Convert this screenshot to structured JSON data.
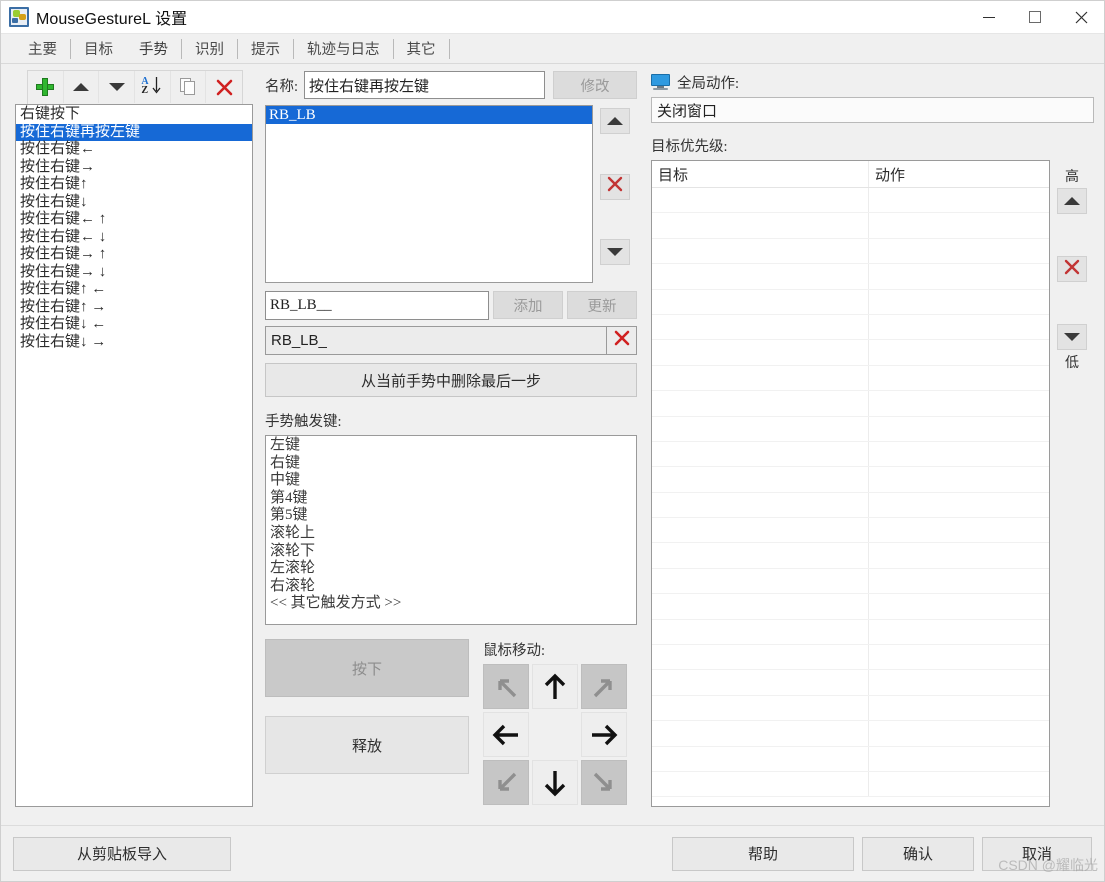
{
  "window": {
    "title": "MouseGestureL 设置",
    "app_icon": "app-icon",
    "minimize": "−",
    "maximize": "□",
    "close": "✕"
  },
  "tabs": [
    {
      "label": "主要",
      "active": false
    },
    {
      "label": "目标",
      "active": false
    },
    {
      "label": "手势",
      "active": true
    },
    {
      "label": "识别",
      "active": false
    },
    {
      "label": "提示",
      "active": false
    },
    {
      "label": "轨迹与日志",
      "active": false
    },
    {
      "label": "其它",
      "active": false
    }
  ],
  "toolbar": {
    "add": "add-icon",
    "move_up": "arrow-up-icon",
    "move_down": "arrow-down-icon",
    "sort": "sort-az-icon",
    "duplicate": "copy-icon",
    "delete": "delete-icon"
  },
  "gesture_list": {
    "items": [
      {
        "label": "右键按下",
        "selected": false
      },
      {
        "label": "按住右键再按左键",
        "selected": true
      },
      {
        "label": "按住右键←",
        "selected": false
      },
      {
        "label": "按住右键→",
        "selected": false
      },
      {
        "label": "按住右键↑",
        "selected": false
      },
      {
        "label": "按住右键↓",
        "selected": false
      },
      {
        "label": "按住右键← ↑",
        "selected": false
      },
      {
        "label": "按住右键← ↓",
        "selected": false
      },
      {
        "label": "按住右键→ ↑",
        "selected": false
      },
      {
        "label": "按住右键→ ↓",
        "selected": false
      },
      {
        "label": "按住右键↑ ←",
        "selected": false
      },
      {
        "label": "按住右键↑ →",
        "selected": false
      },
      {
        "label": "按住右键↓ ←",
        "selected": false
      },
      {
        "label": "按住右键↓ →",
        "selected": false
      }
    ]
  },
  "editor": {
    "name_label": "名称:",
    "name_value": "按住右键再按左键",
    "modify_button": "修改",
    "steps": [
      {
        "label": "RB_LB",
        "selected": true
      }
    ],
    "step_up": "arrow-up-icon",
    "step_delete": "delete-icon",
    "step_down": "arrow-down-icon",
    "add_value": "RB_LB__",
    "add_button": "添加",
    "update_button": "更新",
    "sequence_value": "RB_LB_",
    "sequence_clear": "delete-icon",
    "remove_last_step_button": "从当前手势中删除最后一步"
  },
  "trigger": {
    "label": "手势触发键:",
    "items": [
      "左键",
      "右键",
      "中键",
      "第4键",
      "第5键",
      "滚轮上",
      "滚轮下",
      "左滚轮",
      "右滚轮",
      "<<  其它触发方式  >>"
    ]
  },
  "actions": {
    "press_button": "按下",
    "release_button": "释放",
    "move_label": "鼠标移动:",
    "directions": [
      {
        "name": "up-left",
        "glyph": "↖",
        "enabled": false
      },
      {
        "name": "up",
        "glyph": "↑",
        "enabled": true
      },
      {
        "name": "up-right",
        "glyph": "↗",
        "enabled": false
      },
      {
        "name": "left",
        "glyph": "←",
        "enabled": true
      },
      {
        "name": "center",
        "glyph": "",
        "enabled": false
      },
      {
        "name": "right",
        "glyph": "→",
        "enabled": true
      },
      {
        "name": "down-left",
        "glyph": "↙",
        "enabled": false
      },
      {
        "name": "down",
        "glyph": "↓",
        "enabled": true
      },
      {
        "name": "down-right",
        "glyph": "↘",
        "enabled": false
      }
    ]
  },
  "right_panel": {
    "global_action_label": "全局动作:",
    "global_action_value": "关闭窗口",
    "priority_label": "目标优先级:",
    "table": {
      "columns": [
        "目标",
        "动作"
      ],
      "rows": []
    },
    "high_label": "高",
    "low_label": "低",
    "move_up": "arrow-up-icon",
    "delete": "delete-icon",
    "move_down": "arrow-down-icon"
  },
  "footer": {
    "import_button": "从剪贴板导入",
    "help_button": "帮助",
    "ok_button": "确认",
    "cancel_button": "取消",
    "watermark": "CSDN @耀临光"
  },
  "colors": {
    "selection_blue": "#1669d6",
    "accent_green": "#2fb62f",
    "accent_red": "#d02020",
    "monitor_blue": "#2f9ae0",
    "window_bg": "#f0f0f0"
  }
}
